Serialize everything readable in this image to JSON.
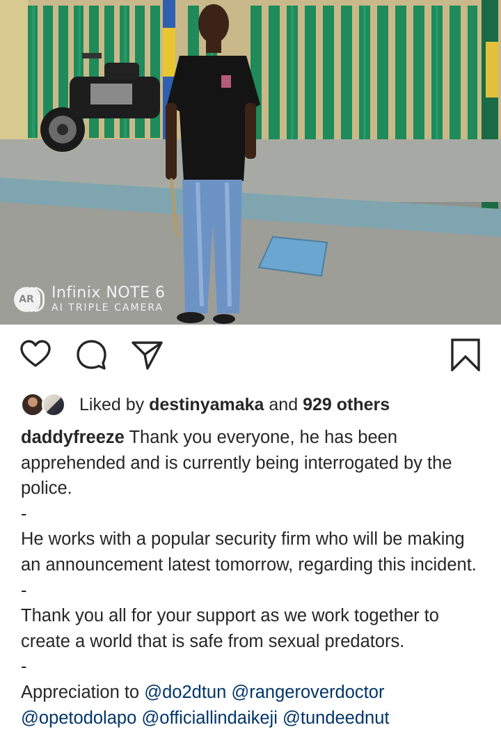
{
  "photo": {
    "watermark_model": "Infinix NOTE 6",
    "watermark_sub": "AI TRIPLE CAMERA",
    "watermark_badge": "AR"
  },
  "actions": {
    "like_icon": "heart-icon",
    "comment_icon": "comment-icon",
    "share_icon": "share-icon",
    "save_icon": "bookmark-icon"
  },
  "likes": {
    "prefix": "Liked by",
    "user": "destinyamaka",
    "middle": "and",
    "others": "929 others"
  },
  "caption": {
    "username": "daddyfreeze",
    "p1": "Thank you everyone, he has been apprehended and is currently being interrogated by the police.",
    "sep1": "-",
    "p2": "He works with a popular security firm who will be making an announcement latest tomorrow, regarding this incident.",
    "sep2": "-",
    "p3": "Thank you all for your support as we work together to create a world that is safe from sexual predators.",
    "sep3": "-",
    "p4_prefix": "Appreciation to",
    "mentions": [
      "@do2dtun",
      "@rangeroverdoctor",
      "@opetodolapo",
      "@officiallindaikeji",
      "@tundeednut"
    ]
  },
  "colors": {
    "text": "#262626",
    "mention": "#003569",
    "background": "#ffffff"
  }
}
